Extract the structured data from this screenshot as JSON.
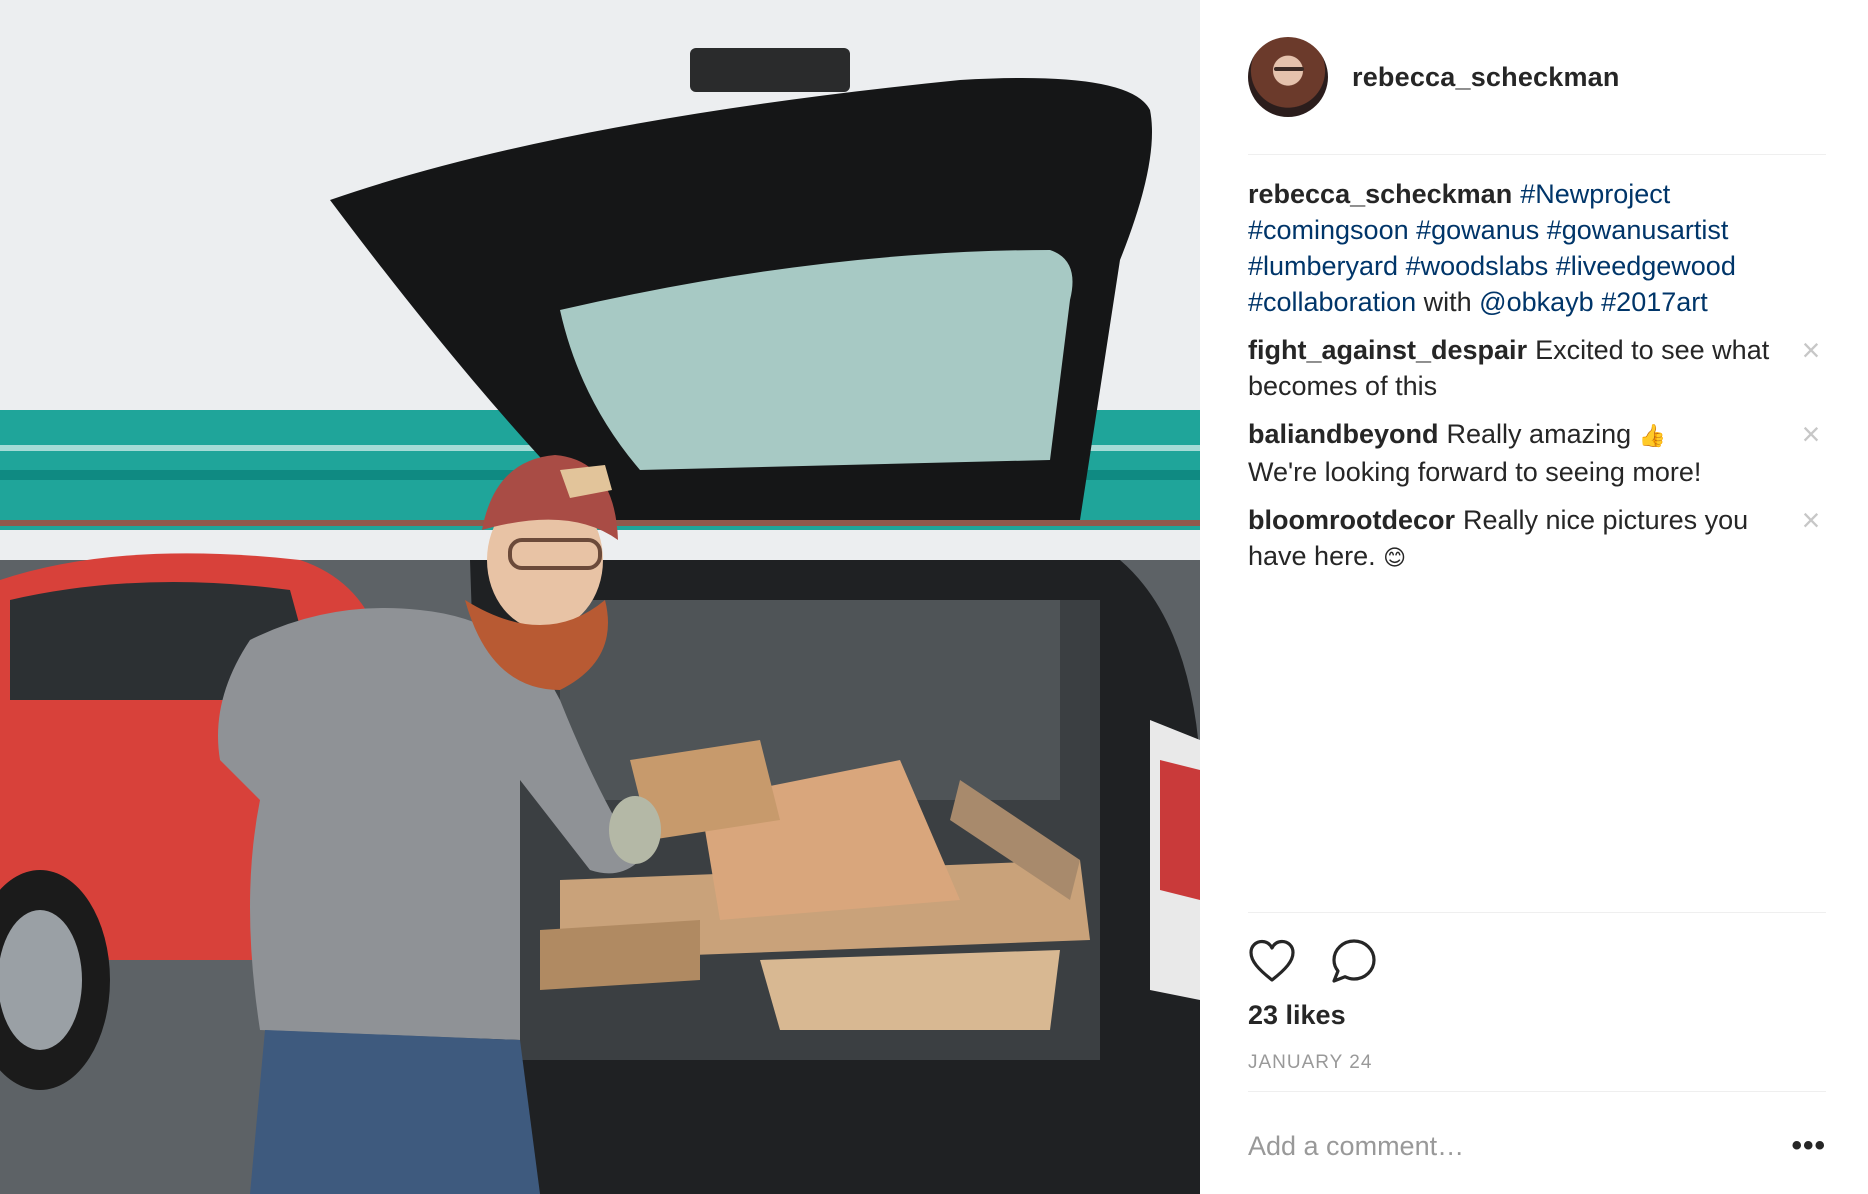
{
  "post": {
    "author": "rebecca_scheckman",
    "caption": {
      "user": "rebecca_scheckman",
      "parts": [
        {
          "text": "#Newproject",
          "tag": true
        },
        {
          "text": " ",
          "tag": false
        },
        {
          "text": "#comingsoon",
          "tag": true
        },
        {
          "text": " ",
          "tag": false
        },
        {
          "text": "#gowanus",
          "tag": true
        },
        {
          "text": " ",
          "tag": false
        },
        {
          "text": "#gowanusartist",
          "tag": true
        },
        {
          "text": " ",
          "tag": false
        },
        {
          "text": "#lumberyard",
          "tag": true
        },
        {
          "text": " ",
          "tag": false
        },
        {
          "text": "#woodslabs",
          "tag": true
        },
        {
          "text": " ",
          "tag": false
        },
        {
          "text": "#liveedgewood",
          "tag": true
        },
        {
          "text": " ",
          "tag": false
        },
        {
          "text": "#collaboration",
          "tag": true
        },
        {
          "text": " with ",
          "tag": false
        },
        {
          "text": "@obkayb",
          "tag": true
        },
        {
          "text": " ",
          "tag": false
        },
        {
          "text": "#2017art",
          "tag": true
        }
      ]
    },
    "comments": [
      {
        "user": "fight_against_despair",
        "text": "Excited to see what becomes of this",
        "emoji": ""
      },
      {
        "user": "baliandbeyond",
        "text": "Really amazing",
        "emoji": "👍",
        "text_after": "We're looking forward to seeing more!"
      },
      {
        "user": "bloomrootdecor",
        "text": "Really nice pictures you have here.",
        "emoji": "😊"
      }
    ],
    "likes": "23 likes",
    "date": "JANUARY 24",
    "comment_placeholder": "Add a comment…",
    "more_label": "•••",
    "close_label": "×"
  },
  "icons": {
    "like": "heart-icon",
    "comment": "speech-bubble-icon",
    "remove_comment": "close-icon",
    "more": "more-options-icon"
  },
  "colors": {
    "text": "#262626",
    "hashtag": "#003569",
    "muted": "#999999",
    "divider": "#efefef"
  }
}
